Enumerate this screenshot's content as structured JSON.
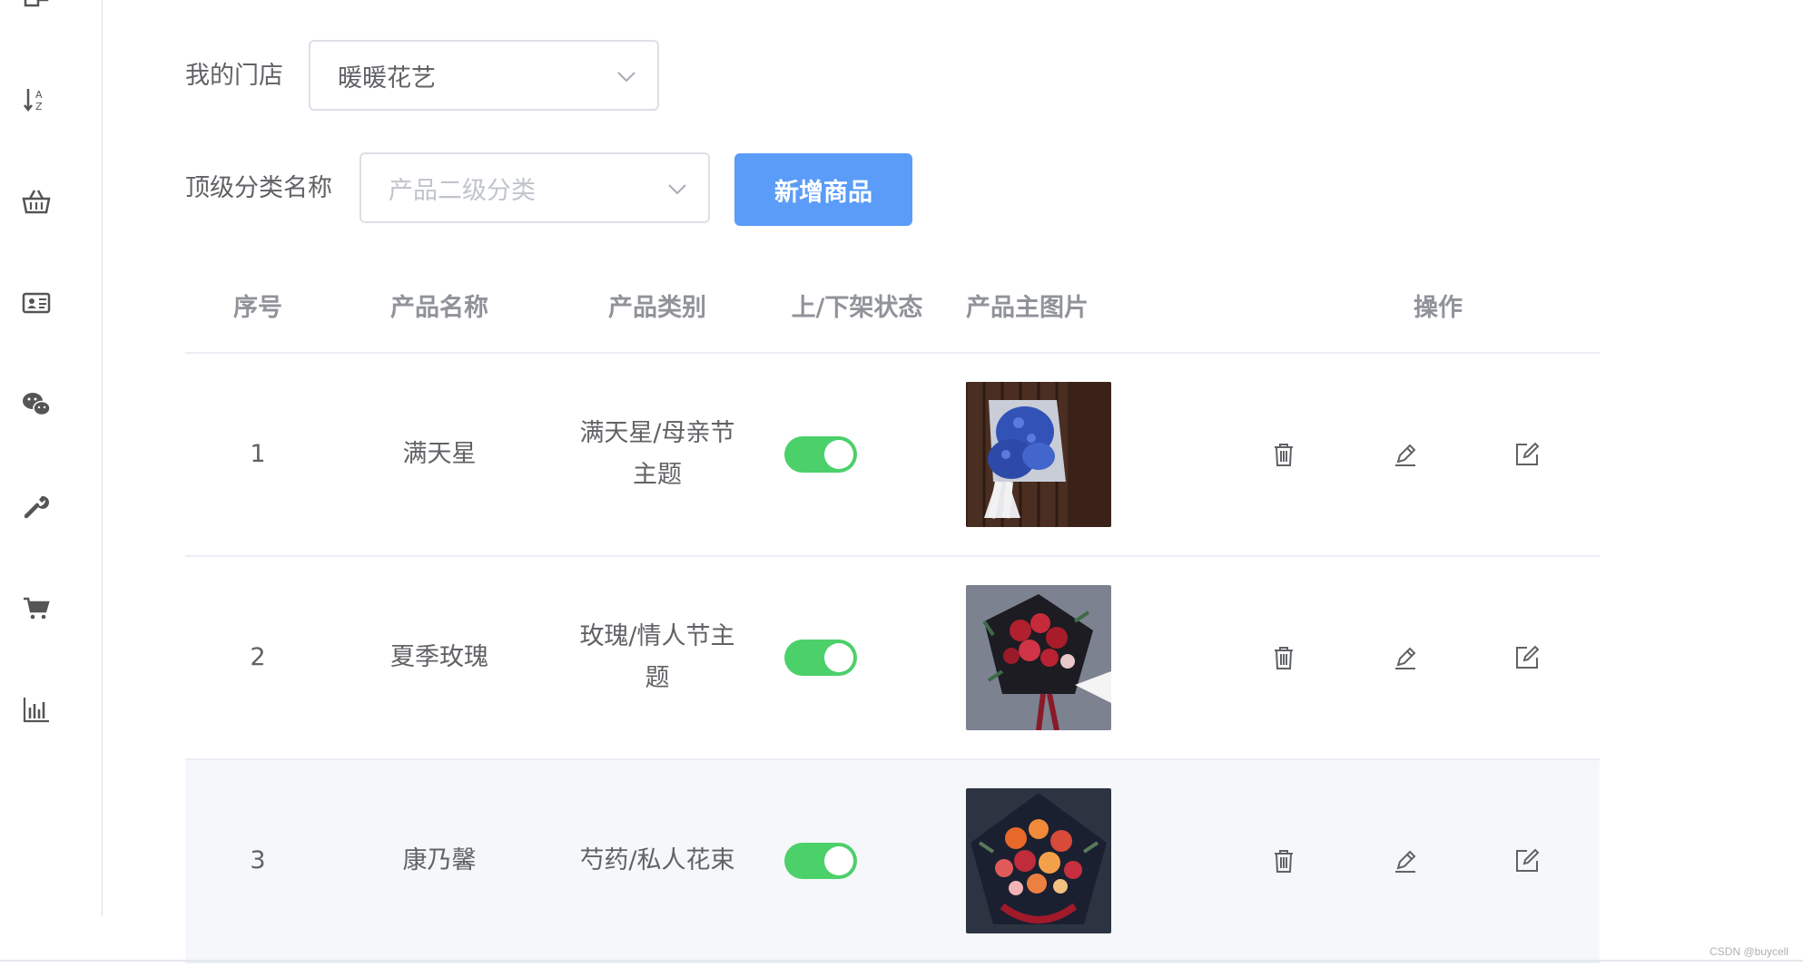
{
  "sidebar": {
    "icons": [
      "windows-icon",
      "sort-alpha-icon",
      "basket-icon",
      "id-card-icon",
      "wechat-icon",
      "wrench-icon",
      "cart-icon",
      "bar-chart-icon"
    ]
  },
  "filters": {
    "store_label": "我的门店",
    "store_value": "暖暖花艺",
    "category_label": "顶级分类名称",
    "category_placeholder": "产品二级分类",
    "add_button": "新增商品"
  },
  "table": {
    "headers": [
      "序号",
      "产品名称",
      "产品类别",
      "上/下架状态",
      "产品主图片",
      "操作"
    ],
    "rows": [
      {
        "index": "1",
        "name": "满天星",
        "category_line1": "满天星/母亲节",
        "category_line2": "主题",
        "status_on": true,
        "image": "blue-bouquet"
      },
      {
        "index": "2",
        "name": "夏季玫瑰",
        "category_line1": "玫瑰/情人节主",
        "category_line2": "题",
        "status_on": true,
        "image": "red-rose-bouquet"
      },
      {
        "index": "3",
        "name": "康乃馨",
        "category_line1": "芍药/私人花束",
        "category_line2": "",
        "status_on": true,
        "image": "mixed-bouquet"
      }
    ],
    "hovered_row": 3
  },
  "colors": {
    "primary": "#5a9cf8",
    "switch_on": "#4cd06a",
    "border": "#dcdfe6"
  },
  "watermark": "CSDN @buycell"
}
